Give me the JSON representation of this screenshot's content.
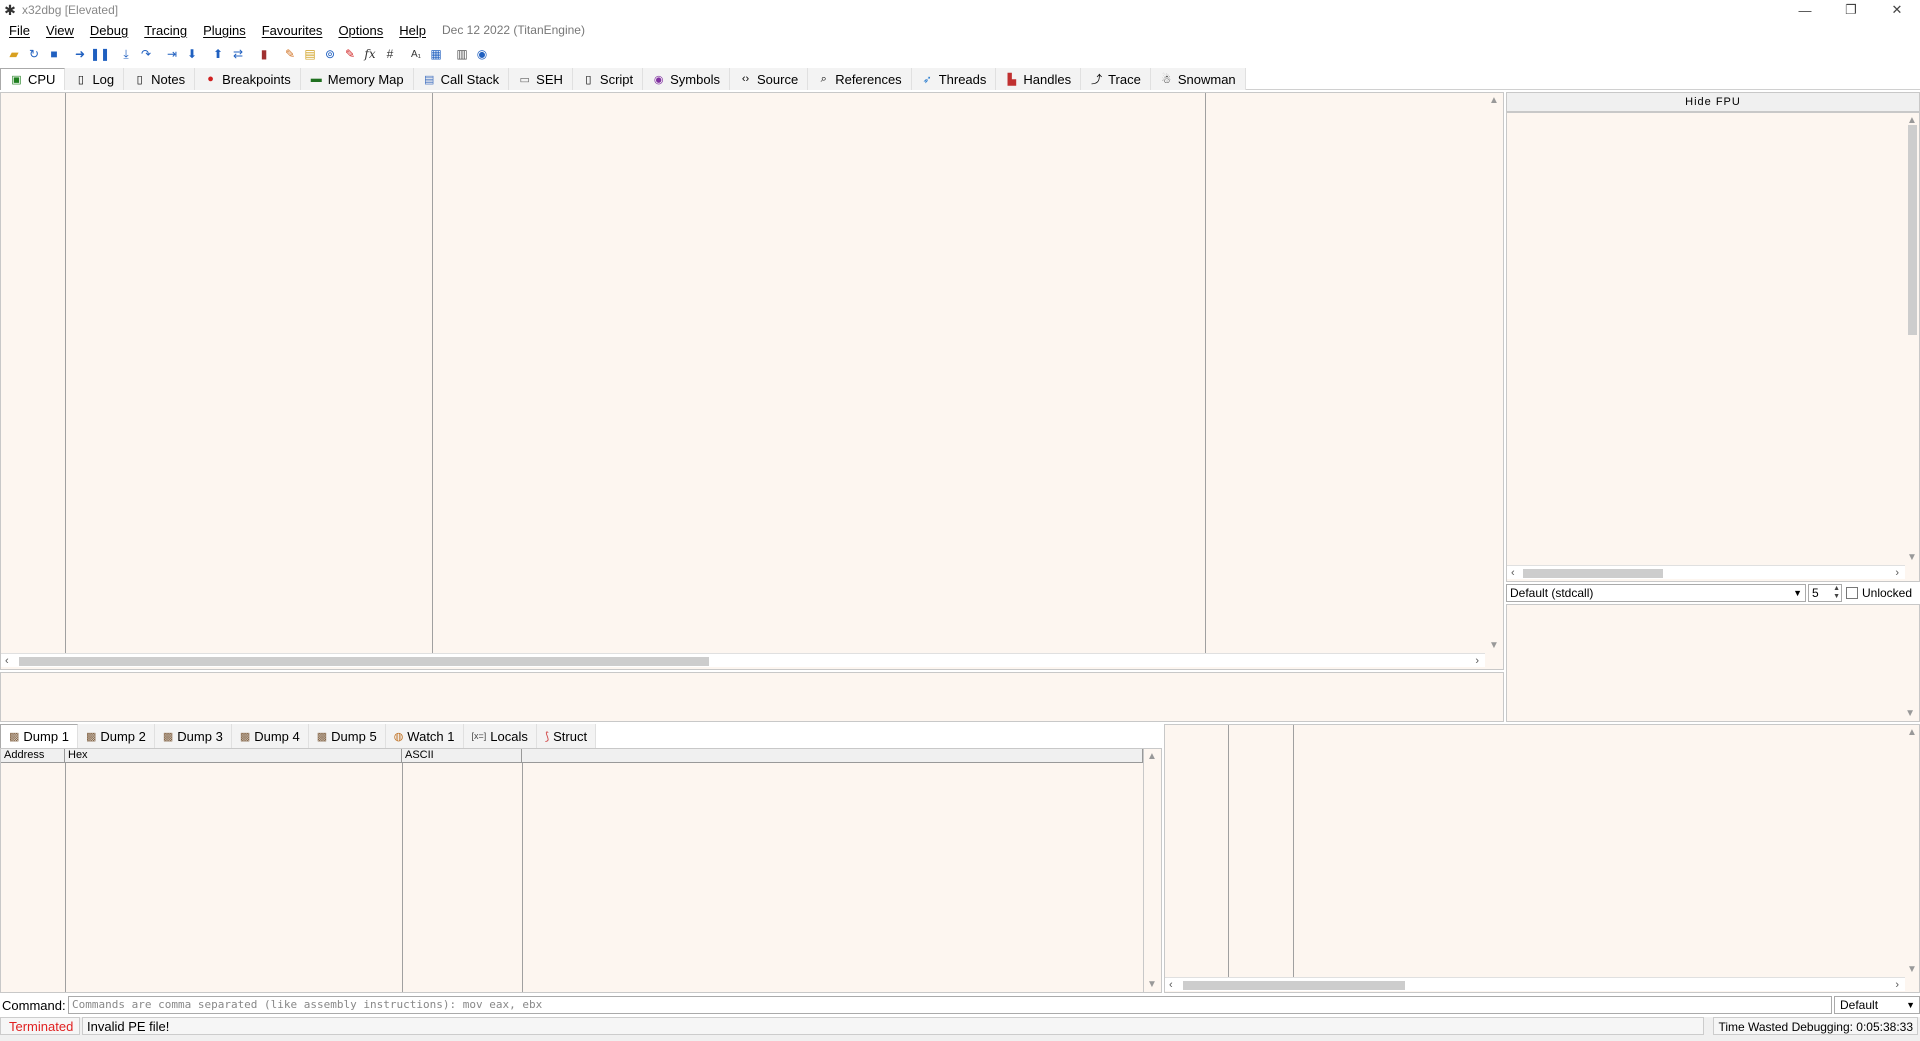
{
  "window": {
    "title": "x32dbg [Elevated]",
    "minimize": "—",
    "maximize": "❐",
    "close": "✕"
  },
  "menu": {
    "items": [
      "File",
      "View",
      "Debug",
      "Tracing",
      "Plugins",
      "Favourites",
      "Options",
      "Help"
    ],
    "build_info": "Dec 12 2022 (TitanEngine)"
  },
  "toolbar": {
    "icons": [
      "open-icon",
      "restart-icon",
      "stop-icon",
      "run-icon",
      "pause-icon",
      "step-into-icon",
      "step-over-icon",
      "trace-into-icon",
      "trace-over-icon",
      "execute-till-return-icon",
      "run-to-user-code-icon",
      "scylla-icon",
      "patch-icon",
      "comment-icon",
      "label-icon",
      "bookmark-icon",
      "function-icon",
      "hash-icon",
      "font-icon",
      "memory-icon",
      "calculator-icon",
      "globe-icon"
    ]
  },
  "tabs": [
    {
      "label": "CPU",
      "icon": "cpu-icon"
    },
    {
      "label": "Log",
      "icon": "log-icon"
    },
    {
      "label": "Notes",
      "icon": "notes-icon"
    },
    {
      "label": "Breakpoints",
      "icon": "breakpoint-icon"
    },
    {
      "label": "Memory Map",
      "icon": "memory-map-icon"
    },
    {
      "label": "Call Stack",
      "icon": "call-stack-icon"
    },
    {
      "label": "SEH",
      "icon": "seh-icon"
    },
    {
      "label": "Script",
      "icon": "script-icon"
    },
    {
      "label": "Symbols",
      "icon": "symbols-icon"
    },
    {
      "label": "Source",
      "icon": "source-icon"
    },
    {
      "label": "References",
      "icon": "references-icon"
    },
    {
      "label": "Threads",
      "icon": "threads-icon"
    },
    {
      "label": "Handles",
      "icon": "handles-icon"
    },
    {
      "label": "Trace",
      "icon": "trace-icon"
    },
    {
      "label": "Snowman",
      "icon": "snowman-icon"
    }
  ],
  "registers": {
    "hide_fpu": "Hide FPU",
    "calling_convention": "Default (stdcall)",
    "arg_count": "5",
    "unlocked_label": "Unlocked"
  },
  "dump": {
    "tabs": [
      {
        "label": "Dump 1",
        "icon": "dump-icon"
      },
      {
        "label": "Dump 2",
        "icon": "dump-icon"
      },
      {
        "label": "Dump 3",
        "icon": "dump-icon"
      },
      {
        "label": "Dump 4",
        "icon": "dump-icon"
      },
      {
        "label": "Dump 5",
        "icon": "dump-icon"
      },
      {
        "label": "Watch 1",
        "icon": "watch-icon"
      },
      {
        "label": "Locals",
        "icon": "locals-icon"
      },
      {
        "label": "Struct",
        "icon": "struct-icon"
      }
    ],
    "columns": [
      "Address",
      "Hex",
      "ASCII"
    ]
  },
  "command": {
    "label": "Command:",
    "placeholder": "Commands are comma separated (like assembly instructions): mov eax, ebx",
    "mode": "Default"
  },
  "status": {
    "state": "Terminated",
    "message": "Invalid PE file!",
    "time": "Time Wasted Debugging: 0:05:38:33"
  }
}
